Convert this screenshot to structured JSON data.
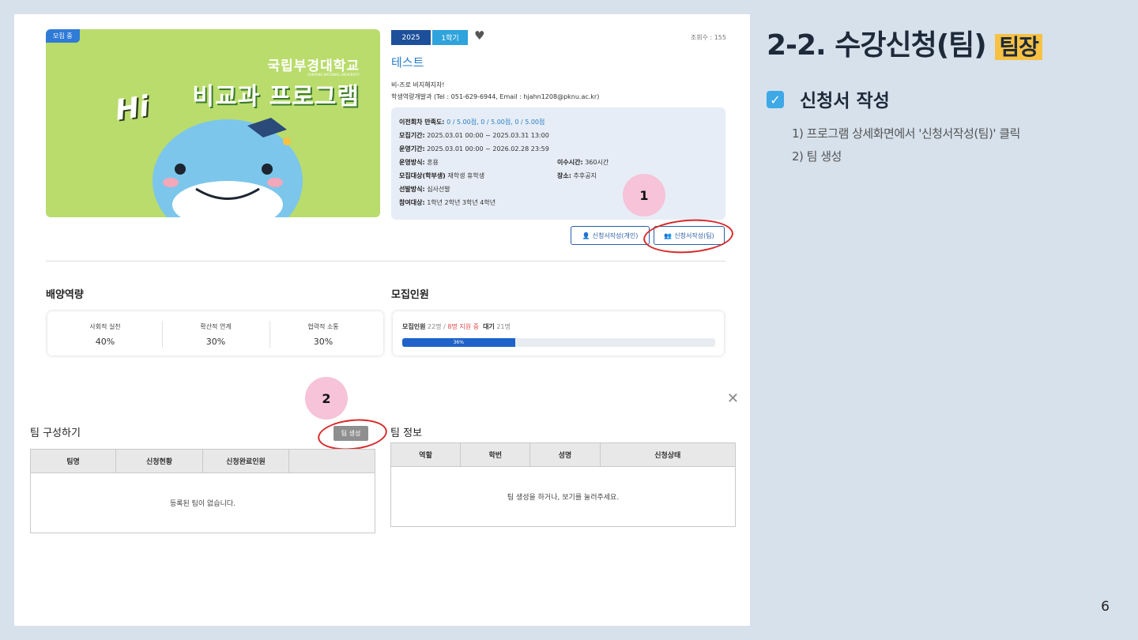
{
  "banner": {
    "badge": "모집 중",
    "university": "국립부경대학교",
    "university_en": "PUKYONG NATIONAL UNIVERSITY",
    "program_title": "비교과 프로그램",
    "hi": "Hi"
  },
  "program": {
    "year_tag": "2025",
    "semester_tag": "1학기",
    "views": "조회수 : 155",
    "name": "테스트",
    "desc": "비-즈로 비지해지자!",
    "contact": "학생역량개발과 (Tel : 051-629-6944, Email : hjahn1208@pknu.ac.kr)"
  },
  "info": {
    "satisfaction_label": "이전회차 만족도:",
    "satisfaction_value": "0 / 5.00점,  0 / 5.00점,  0 / 5.00점",
    "recruit_period_label": "모집기간:",
    "recruit_period_value": "2025.03.01 00:00  ~  2025.03.31 13:00",
    "run_period_label": "운영기간:",
    "run_period_value": "2025.03.01 00:00  ~  2026.02.28  23:59",
    "method_label": "운영방식:",
    "method_value": "혼용",
    "hours_label": "이수시간:",
    "hours_value": "360시간",
    "target_label": "모집대상(학부생)",
    "target_value": "재학생 휴학생",
    "place_label": "장소:",
    "place_value": "추후공지",
    "selection_label": "선발방식:",
    "selection_value": "심사선발",
    "grade_label": "참여대상:",
    "grade_value": "1학년 2학년 3학년 4학년"
  },
  "annotations": {
    "step1": "1",
    "step2": "2"
  },
  "buttons": {
    "apply_individual": "신청서작성(개인)",
    "apply_team": "신청서작성(팀)",
    "create_team": "팀 생성"
  },
  "competency": {
    "heading": "배양역량",
    "items": [
      {
        "name": "사회적 실천",
        "pct": "40%"
      },
      {
        "name": "확산적 연계",
        "pct": "30%"
      },
      {
        "name": "협력적 소통",
        "pct": "30%"
      }
    ]
  },
  "recruit": {
    "heading": "모집인원",
    "total_label": "모집인원",
    "total": "22명",
    "sep": "/",
    "applied": "8명 지원 중",
    "wait_label": "대기",
    "wait": "21명",
    "progress_label": "36%",
    "progress": 0.36
  },
  "team_compose": {
    "heading": "팀 구성하기",
    "columns": [
      "팀명",
      "신청현황",
      "신청완료인원",
      ""
    ],
    "empty": "등록된 팀이 없습니다."
  },
  "team_info": {
    "heading": "팀 정보",
    "columns": [
      "역할",
      "학번",
      "성명",
      "신청상태"
    ],
    "empty": "팀 생성을 하거나, 보기를 눌러주세요."
  },
  "slide": {
    "title": "2-2. 수강신청(팀)",
    "title_badge": "팀장",
    "step_head": "신청서 작성",
    "step1": "1) 프로그램 상세화면에서 '신청서작성(팀)' 클릭",
    "step2": "2) 팀 생성",
    "page": "6"
  },
  "colors": {
    "accent_blue": "#2a7ec8",
    "highlight_yellow": "#f7c244",
    "annotation_red": "#d62a2a",
    "annotation_pink": "#f6c3d8"
  }
}
